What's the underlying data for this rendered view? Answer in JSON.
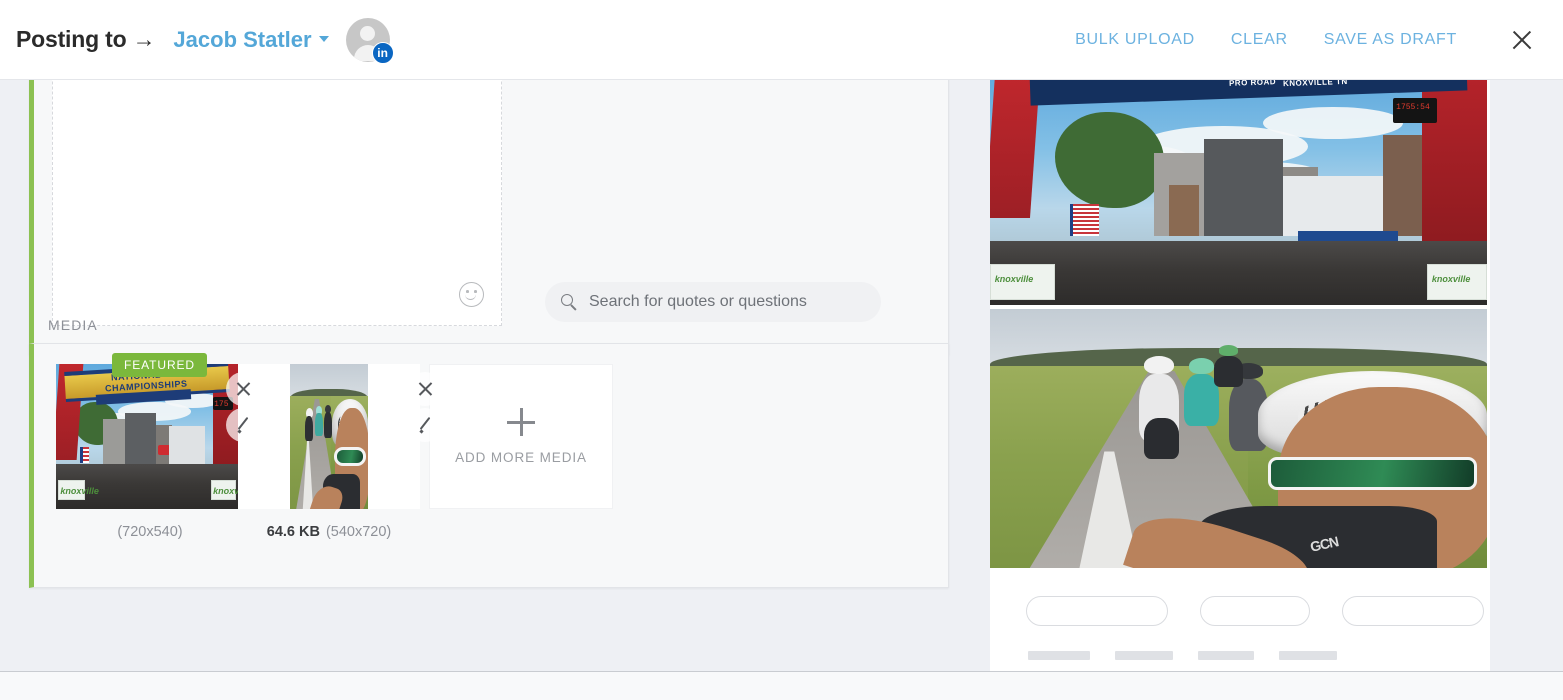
{
  "header": {
    "posting_to_label": "Posting to →",
    "account_name": "Jacob Statler",
    "account_caret_icon": "chevron-down-icon",
    "avatar_icon": "user-avatar-icon",
    "social_badge": "in",
    "actions": [
      {
        "label": "BULK UPLOAD",
        "name": "bulk-upload-button"
      },
      {
        "label": "CLEAR",
        "name": "clear-button"
      },
      {
        "label": "SAVE AS DRAFT",
        "name": "save-as-draft-button"
      }
    ],
    "close_icon": "close-icon"
  },
  "composer": {
    "textarea_value": "",
    "textarea_placeholder": "",
    "emoji_icon": "emoji-smiley-icon"
  },
  "quote_search": {
    "icon": "search-icon",
    "placeholder": "Search for quotes or questions",
    "value": ""
  },
  "media": {
    "section_label": "MEDIA",
    "items": [
      {
        "name": "media-thumbnail-1",
        "badge": "FEATURED",
        "file_size": "",
        "dimensions": "(720x540)",
        "alt": "National Championships start line with cyclists",
        "remove_icon": "close-icon",
        "edit_icon": "pencil-icon"
      },
      {
        "name": "media-thumbnail-2",
        "badge": "",
        "file_size": "64.6 KB",
        "dimensions": "(540x720)",
        "alt": "Cyclist selfie on country road",
        "remove_icon": "close-icon",
        "edit_icon": "pencil-icon"
      }
    ],
    "add_more": {
      "label": "ADD MORE MEDIA",
      "icon": "plus-icon"
    }
  },
  "preview": {
    "images": [
      {
        "alt": "PRO ROAD KNOXVILLE TN race start arch with peloton"
      },
      {
        "alt": "Group road ride selfie in green fields"
      }
    ],
    "banner_text_1": "PRO ROAD",
    "banner_text_2": "KNOXVILLE TN",
    "clock_text": "1755:54",
    "barrier_text_left": "knoxville",
    "barrier_text_right": "knoxville",
    "arch_text_top": "NATIONAL",
    "arch_text_bottom": "CHAMPIONSHIPS",
    "jersey_text": "GCN"
  },
  "colors": {
    "accent_green": "#8cc152",
    "badge_green": "#7bb83c",
    "link_blue": "#54a7d8",
    "action_blue": "#6cb2e0",
    "page_bg": "#eef0f4",
    "card_bg": "#f7f8f9",
    "social_blue": "#0a66c2"
  }
}
